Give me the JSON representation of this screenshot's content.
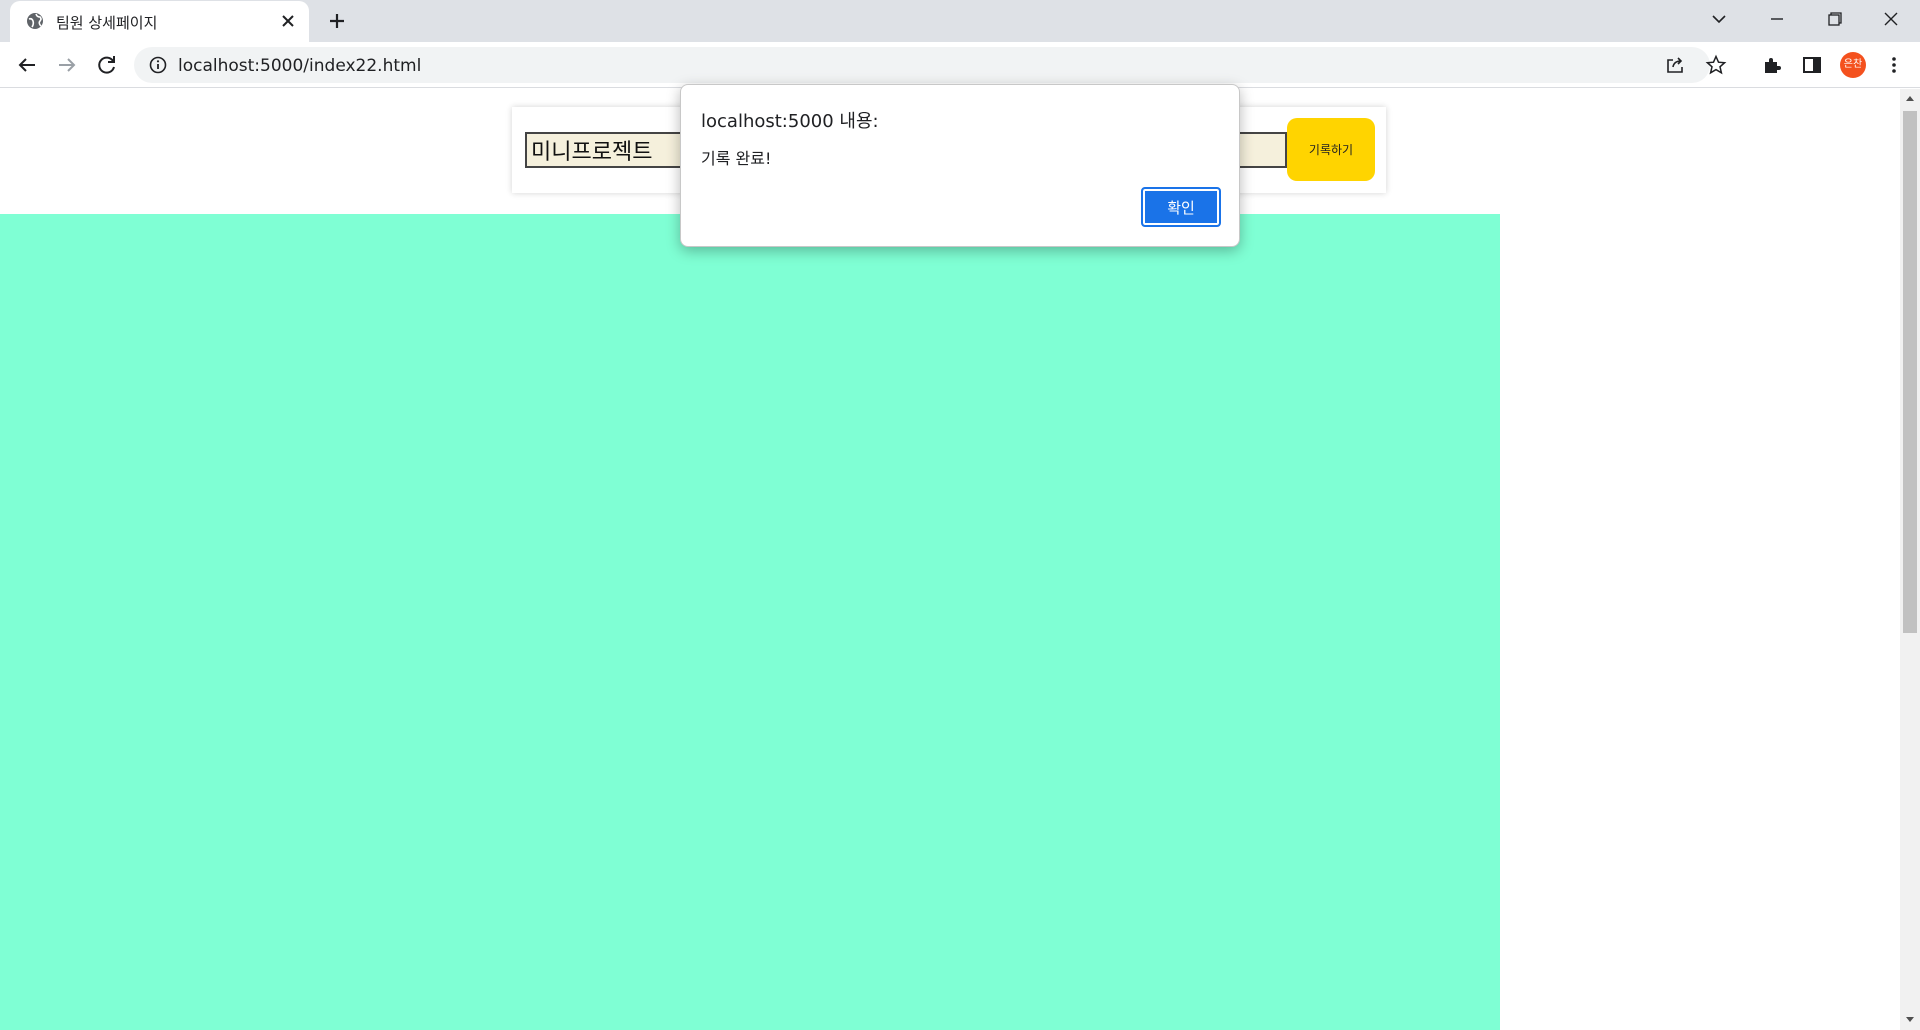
{
  "browser": {
    "tab_title": "팀원 상세페이지",
    "url": "localhost:5000/index22.html",
    "profile_initials": "은찬"
  },
  "page": {
    "memo_value": "미니프로젝트",
    "save_button_label": "기록하기",
    "accent_color": "#7fffd4",
    "button_color": "#ffd400"
  },
  "alert": {
    "title": "localhost:5000 내용:",
    "message": "기록 완료!",
    "ok_label": "확인"
  },
  "icons": [
    "globe-icon",
    "close-icon",
    "plus-icon",
    "chevron-down-icon",
    "minimize-icon",
    "restore-icon",
    "window-close-icon",
    "back-icon",
    "forward-icon",
    "reload-icon",
    "info-icon",
    "share-icon",
    "star-icon",
    "extensions-icon",
    "side-panel-icon",
    "menu-icon"
  ]
}
